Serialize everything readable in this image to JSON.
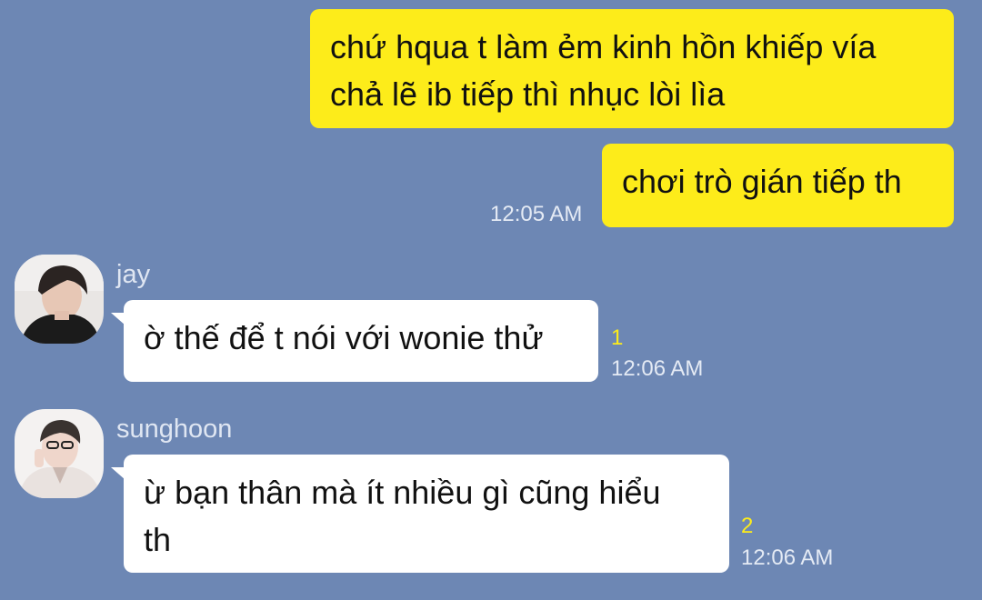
{
  "messages": {
    "m1": {
      "lines": [
        "chứ hqua t làm ẻm kinh hồn khiếp vía",
        "chả lẽ ib tiếp thì nhục lòi lìa"
      ]
    },
    "m2": {
      "text": "chơi trò gián tiếp th",
      "time": "12:05 AM"
    },
    "m3": {
      "sender": "jay",
      "text": "ờ thế để t nói với wonie thử",
      "read_count": "1",
      "time": "12:06 AM"
    },
    "m4": {
      "sender": "sunghoon",
      "lines": [
        "ừ bạn thân mà ít nhiều gì cũng hiểu",
        "th"
      ],
      "read_count": "2",
      "time": "12:06 AM"
    }
  },
  "colors": {
    "background": "#6d87b4",
    "my_bubble": "#fdec1a",
    "their_bubble": "#ffffff",
    "read_count": "#fdec1a"
  },
  "icons": {
    "avatar_jay": "avatar-jay",
    "avatar_sunghoon": "avatar-sunghoon"
  }
}
